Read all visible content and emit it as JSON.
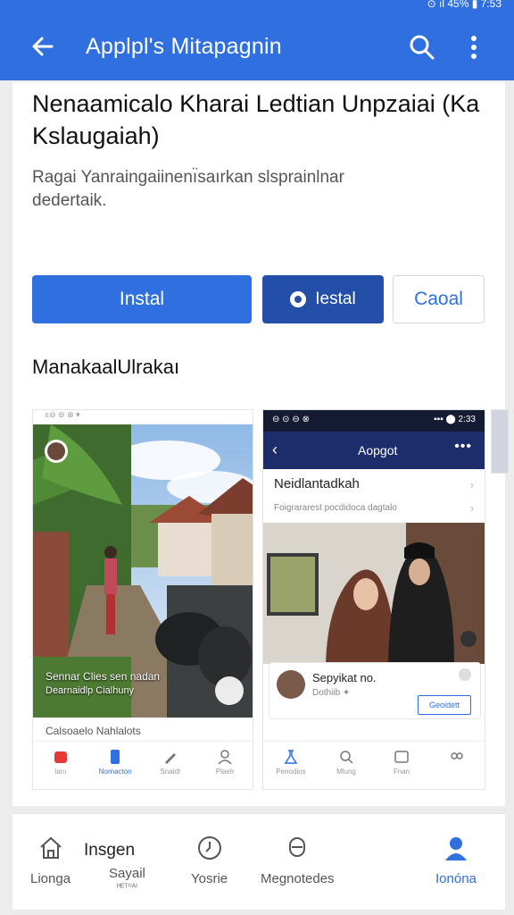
{
  "status_bar": {
    "right_text": "⊙ ıl 45% ▮ 7:53"
  },
  "app_bar": {
    "title": "Applpl's Mitapagnin"
  },
  "headline": "Nenaamicalo Kharai Ledtian Unpzaiai (Ka Kslaugaiah)",
  "description": "Ragai Yanraingaiinenı̈saırkan slsprainlnar dedertaik.",
  "buttons": {
    "primary": "Instal",
    "secondary": "Iestal",
    "outline": "Caoal"
  },
  "section_title": "ManakaalUlrakaı",
  "screenshot_a": {
    "status": "ε⊖ ⊜ ⊗ ▾",
    "caption_line1": "Sennar Clies sen nadan",
    "caption_line2": "Dearnaidlp Cialhuny",
    "row_label": "Calsoaelo Nahlalots",
    "nav": [
      "Ianı",
      "Nornacton",
      "Snaidt",
      "Plaetr"
    ]
  },
  "screenshot_b": {
    "status_left": "⊖ ⊝ ⊖ ⊗",
    "status_right": "▪▪▪ ⬤ 2:33",
    "bar_title": "Aopgot",
    "row_title": "Neidlantadkah",
    "row_sub": "Foigrararest pocdidoca dagtalo",
    "post_name": "Sepyikat no.",
    "post_sub": "Dothiib ✦",
    "post_button": "Geoidett",
    "nav": [
      "Penodios",
      "Mlung",
      "Fnan",
      ""
    ]
  },
  "bottom_nav": {
    "home_text": "Insgen",
    "items": [
      {
        "label": "Lionga",
        "sub": ""
      },
      {
        "label": "Sayail",
        "sub": "ᴴᴱᵀ⁰ᴬᴵ"
      },
      {
        "label": "Yosrie",
        "sub": ""
      },
      {
        "label": "Megnotedes",
        "sub": ""
      },
      {
        "label": "Ionóna",
        "sub": ""
      }
    ]
  },
  "colors": {
    "accent": "#2f6fe0",
    "dark_accent": "#234fa8",
    "navy": "#1d2d6b"
  }
}
